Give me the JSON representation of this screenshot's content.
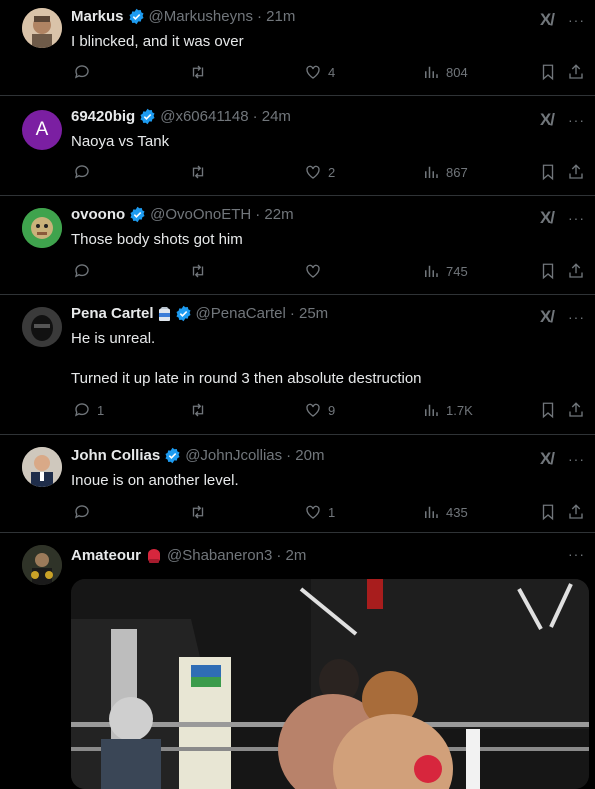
{
  "tweets": [
    {
      "name": "Markus",
      "handle": "@Markusheyns",
      "time": "· 21m",
      "text": "I blincked, and it was over",
      "reply": "",
      "like": "4",
      "views": "804",
      "avatar_letter": "",
      "avatar_color": "#c8a98a"
    },
    {
      "name": "69420big",
      "handle": "@x60641148",
      "time": "· 24m",
      "text": "Naoya vs Tank",
      "reply": "",
      "like": "2",
      "views": "867",
      "avatar_letter": "A",
      "avatar_color": "#7b1fa2"
    },
    {
      "name": "ovoono",
      "handle": "@OvoOnoETH",
      "time": "· 22m",
      "text": "Those body shots got him",
      "reply": "",
      "like": "",
      "views": "745",
      "avatar_letter": "",
      "avatar_color": "#4caf50"
    },
    {
      "name": "Pena Cartel",
      "handle": "@PenaCartel",
      "time": "· 25m",
      "text": "He is unreal.",
      "text2": "Turned it up late in round 3 then absolute destruction",
      "reply": "1",
      "like": "9",
      "views": "1.7K",
      "avatar_letter": "",
      "avatar_color": "#2a2a2a"
    },
    {
      "name": "John Collias",
      "handle": "@JohnJcollias",
      "time": "· 20m",
      "text": "Inoue is on another level.",
      "reply": "",
      "like": "1",
      "views": "435",
      "avatar_letter": "",
      "avatar_color": "#d6d0c8"
    },
    {
      "name": "Amateour",
      "handle": "@Shabaneron3",
      "time": "· 2m",
      "text": "",
      "avatar_letter": "",
      "avatar_color": "#3a3a2a"
    }
  ],
  "icons": {
    "grok": "grok-icon",
    "more": "more-icon",
    "reply": "reply-icon",
    "retweet": "retweet-icon",
    "like": "like-icon",
    "views": "views-icon",
    "bookmark": "bookmark-icon",
    "share": "share-icon"
  },
  "colors": {
    "background": "#000000",
    "text": "#e7e9ea",
    "muted": "#71767b",
    "verified": "#1d9bf0",
    "divider": "#2f3336"
  },
  "grok_label": "X/",
  "more_label": "···"
}
